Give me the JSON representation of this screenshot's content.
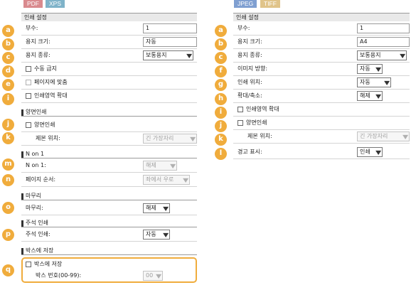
{
  "tabs_left": [
    "PDF",
    "XPS"
  ],
  "tabs_right": [
    "JPEG",
    "TIFF"
  ],
  "left": {
    "header": "인쇄 설정",
    "copies": {
      "badge": "a",
      "label": "부수:",
      "value": "1"
    },
    "paper_size": {
      "badge": "b",
      "label": "용지 크기:",
      "value": "자동"
    },
    "paper_type": {
      "badge": "c",
      "label": "용지 종류:",
      "value": "보통용지"
    },
    "manual_feed": {
      "badge": "d",
      "label": "수동 급지"
    },
    "fit_page": {
      "badge": "e",
      "label": "페이지에 맞춤"
    },
    "enlarge_area": {
      "badge": "i",
      "label": "인쇄영역 확대"
    },
    "duplex_section": "양면인쇄",
    "duplex": {
      "badge": "j",
      "label": "양면인쇄"
    },
    "binding": {
      "badge": "k",
      "label": "제본 위치:",
      "value": "긴 가장자리"
    },
    "nup_section": "N on 1",
    "nup": {
      "badge": "m",
      "label": "N on 1:",
      "value": "해제"
    },
    "page_order": {
      "badge": "n",
      "label": "페이지 순서:",
      "value": "좌에서 우로"
    },
    "finish_section": "마무리",
    "finishing": {
      "badge": "o",
      "label": "마무리:",
      "value": "해제"
    },
    "annot_section": "주석 인쇄",
    "annotation": {
      "badge": "p",
      "label": "주석 인쇄:",
      "value": "자동"
    },
    "box_section": "박스에 저장",
    "save_box": {
      "badge": "q",
      "label": "박스에 저장"
    },
    "box_number": {
      "label": "박스 번호(00-99):",
      "value": "00"
    }
  },
  "right": {
    "header": "인쇄 설정",
    "copies": {
      "badge": "a",
      "label": "부수:",
      "value": "1"
    },
    "paper_size": {
      "badge": "b",
      "label": "용지 크기:",
      "value": "A4"
    },
    "paper_type": {
      "badge": "c",
      "label": "용지 종류:",
      "value": "보통용지"
    },
    "orientation": {
      "badge": "f",
      "label": "이미지 방향:",
      "value": "자동"
    },
    "position": {
      "badge": "g",
      "label": "인쇄 위치:",
      "value": "자동"
    },
    "zoom": {
      "badge": "h",
      "label": "확대/축소:",
      "value": "해제"
    },
    "enlarge_area": {
      "badge": "i",
      "label": "인쇄영역 확대"
    },
    "duplex": {
      "badge": "j",
      "label": "양면인쇄"
    },
    "binding": {
      "badge": "k",
      "label": "제본 위치:",
      "value": "긴 가장자리"
    },
    "warning": {
      "badge": "l",
      "label": "경고 표시:",
      "value": "인쇄"
    }
  },
  "icons": {
    "dropdown": "chevron-down-icon",
    "checkbox": "checkbox-icon"
  },
  "colors": {
    "badge": "#f0ac3c",
    "pdf_tab": "#d98a8e",
    "xps_tab": "#7fb3c9",
    "jpeg_tab": "#7f9fd1",
    "tiff_tab": "#e0c48a"
  }
}
